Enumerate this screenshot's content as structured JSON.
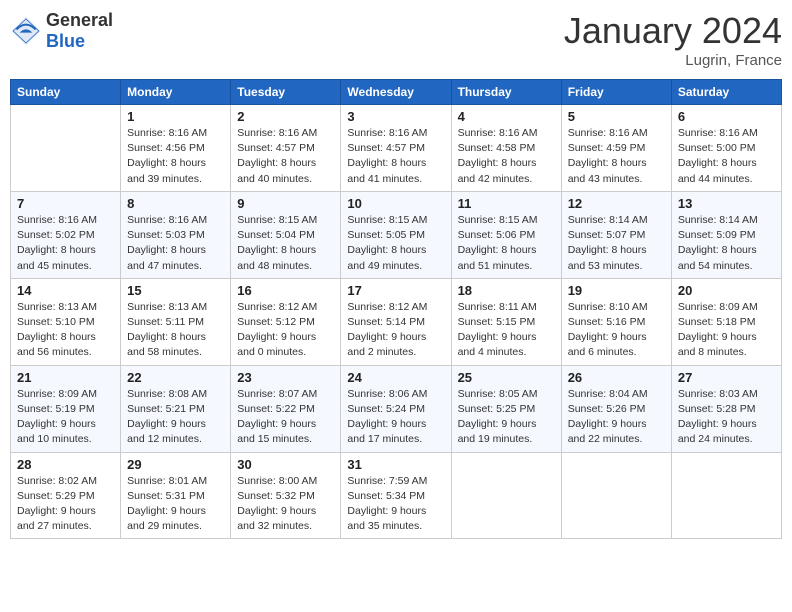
{
  "header": {
    "logo": {
      "general": "General",
      "blue": "Blue"
    },
    "title": "January 2024",
    "location": "Lugrin, France"
  },
  "calendar": {
    "days_of_week": [
      "Sunday",
      "Monday",
      "Tuesday",
      "Wednesday",
      "Thursday",
      "Friday",
      "Saturday"
    ],
    "weeks": [
      [
        {
          "day": "",
          "sunrise": "",
          "sunset": "",
          "daylight": ""
        },
        {
          "day": "1",
          "sunrise": "Sunrise: 8:16 AM",
          "sunset": "Sunset: 4:56 PM",
          "daylight": "Daylight: 8 hours and 39 minutes."
        },
        {
          "day": "2",
          "sunrise": "Sunrise: 8:16 AM",
          "sunset": "Sunset: 4:57 PM",
          "daylight": "Daylight: 8 hours and 40 minutes."
        },
        {
          "day": "3",
          "sunrise": "Sunrise: 8:16 AM",
          "sunset": "Sunset: 4:57 PM",
          "daylight": "Daylight: 8 hours and 41 minutes."
        },
        {
          "day": "4",
          "sunrise": "Sunrise: 8:16 AM",
          "sunset": "Sunset: 4:58 PM",
          "daylight": "Daylight: 8 hours and 42 minutes."
        },
        {
          "day": "5",
          "sunrise": "Sunrise: 8:16 AM",
          "sunset": "Sunset: 4:59 PM",
          "daylight": "Daylight: 8 hours and 43 minutes."
        },
        {
          "day": "6",
          "sunrise": "Sunrise: 8:16 AM",
          "sunset": "Sunset: 5:00 PM",
          "daylight": "Daylight: 8 hours and 44 minutes."
        }
      ],
      [
        {
          "day": "7",
          "sunrise": "Sunrise: 8:16 AM",
          "sunset": "Sunset: 5:02 PM",
          "daylight": "Daylight: 8 hours and 45 minutes."
        },
        {
          "day": "8",
          "sunrise": "Sunrise: 8:16 AM",
          "sunset": "Sunset: 5:03 PM",
          "daylight": "Daylight: 8 hours and 47 minutes."
        },
        {
          "day": "9",
          "sunrise": "Sunrise: 8:15 AM",
          "sunset": "Sunset: 5:04 PM",
          "daylight": "Daylight: 8 hours and 48 minutes."
        },
        {
          "day": "10",
          "sunrise": "Sunrise: 8:15 AM",
          "sunset": "Sunset: 5:05 PM",
          "daylight": "Daylight: 8 hours and 49 minutes."
        },
        {
          "day": "11",
          "sunrise": "Sunrise: 8:15 AM",
          "sunset": "Sunset: 5:06 PM",
          "daylight": "Daylight: 8 hours and 51 minutes."
        },
        {
          "day": "12",
          "sunrise": "Sunrise: 8:14 AM",
          "sunset": "Sunset: 5:07 PM",
          "daylight": "Daylight: 8 hours and 53 minutes."
        },
        {
          "day": "13",
          "sunrise": "Sunrise: 8:14 AM",
          "sunset": "Sunset: 5:09 PM",
          "daylight": "Daylight: 8 hours and 54 minutes."
        }
      ],
      [
        {
          "day": "14",
          "sunrise": "Sunrise: 8:13 AM",
          "sunset": "Sunset: 5:10 PM",
          "daylight": "Daylight: 8 hours and 56 minutes."
        },
        {
          "day": "15",
          "sunrise": "Sunrise: 8:13 AM",
          "sunset": "Sunset: 5:11 PM",
          "daylight": "Daylight: 8 hours and 58 minutes."
        },
        {
          "day": "16",
          "sunrise": "Sunrise: 8:12 AM",
          "sunset": "Sunset: 5:12 PM",
          "daylight": "Daylight: 9 hours and 0 minutes."
        },
        {
          "day": "17",
          "sunrise": "Sunrise: 8:12 AM",
          "sunset": "Sunset: 5:14 PM",
          "daylight": "Daylight: 9 hours and 2 minutes."
        },
        {
          "day": "18",
          "sunrise": "Sunrise: 8:11 AM",
          "sunset": "Sunset: 5:15 PM",
          "daylight": "Daylight: 9 hours and 4 minutes."
        },
        {
          "day": "19",
          "sunrise": "Sunrise: 8:10 AM",
          "sunset": "Sunset: 5:16 PM",
          "daylight": "Daylight: 9 hours and 6 minutes."
        },
        {
          "day": "20",
          "sunrise": "Sunrise: 8:09 AM",
          "sunset": "Sunset: 5:18 PM",
          "daylight": "Daylight: 9 hours and 8 minutes."
        }
      ],
      [
        {
          "day": "21",
          "sunrise": "Sunrise: 8:09 AM",
          "sunset": "Sunset: 5:19 PM",
          "daylight": "Daylight: 9 hours and 10 minutes."
        },
        {
          "day": "22",
          "sunrise": "Sunrise: 8:08 AM",
          "sunset": "Sunset: 5:21 PM",
          "daylight": "Daylight: 9 hours and 12 minutes."
        },
        {
          "day": "23",
          "sunrise": "Sunrise: 8:07 AM",
          "sunset": "Sunset: 5:22 PM",
          "daylight": "Daylight: 9 hours and 15 minutes."
        },
        {
          "day": "24",
          "sunrise": "Sunrise: 8:06 AM",
          "sunset": "Sunset: 5:24 PM",
          "daylight": "Daylight: 9 hours and 17 minutes."
        },
        {
          "day": "25",
          "sunrise": "Sunrise: 8:05 AM",
          "sunset": "Sunset: 5:25 PM",
          "daylight": "Daylight: 9 hours and 19 minutes."
        },
        {
          "day": "26",
          "sunrise": "Sunrise: 8:04 AM",
          "sunset": "Sunset: 5:26 PM",
          "daylight": "Daylight: 9 hours and 22 minutes."
        },
        {
          "day": "27",
          "sunrise": "Sunrise: 8:03 AM",
          "sunset": "Sunset: 5:28 PM",
          "daylight": "Daylight: 9 hours and 24 minutes."
        }
      ],
      [
        {
          "day": "28",
          "sunrise": "Sunrise: 8:02 AM",
          "sunset": "Sunset: 5:29 PM",
          "daylight": "Daylight: 9 hours and 27 minutes."
        },
        {
          "day": "29",
          "sunrise": "Sunrise: 8:01 AM",
          "sunset": "Sunset: 5:31 PM",
          "daylight": "Daylight: 9 hours and 29 minutes."
        },
        {
          "day": "30",
          "sunrise": "Sunrise: 8:00 AM",
          "sunset": "Sunset: 5:32 PM",
          "daylight": "Daylight: 9 hours and 32 minutes."
        },
        {
          "day": "31",
          "sunrise": "Sunrise: 7:59 AM",
          "sunset": "Sunset: 5:34 PM",
          "daylight": "Daylight: 9 hours and 35 minutes."
        },
        {
          "day": "",
          "sunrise": "",
          "sunset": "",
          "daylight": ""
        },
        {
          "day": "",
          "sunrise": "",
          "sunset": "",
          "daylight": ""
        },
        {
          "day": "",
          "sunrise": "",
          "sunset": "",
          "daylight": ""
        }
      ]
    ]
  }
}
